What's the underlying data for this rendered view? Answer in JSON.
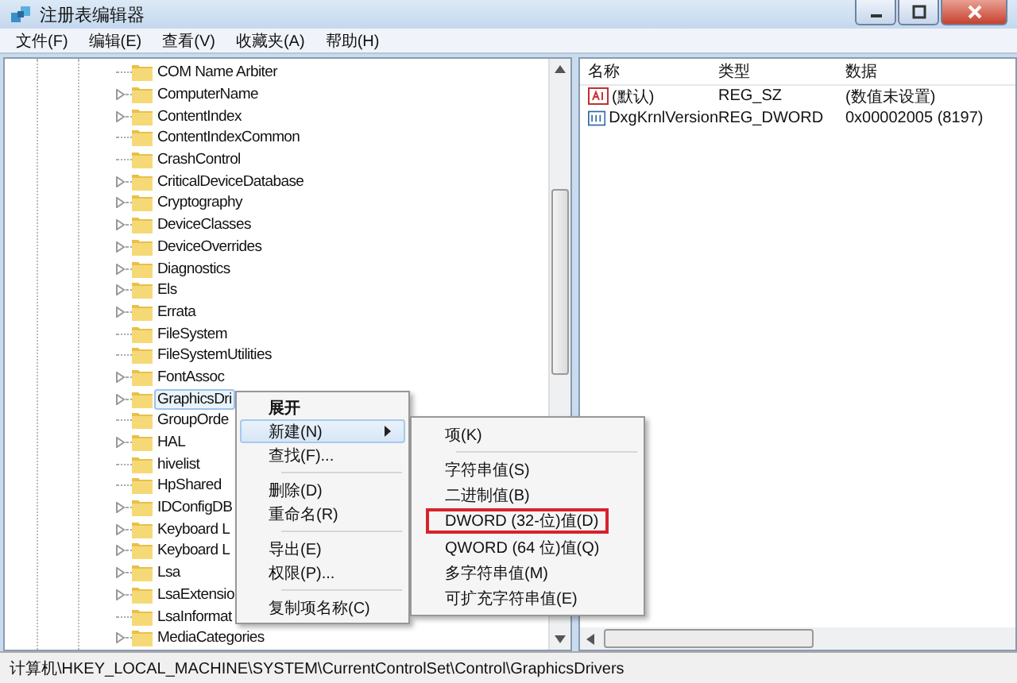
{
  "window": {
    "title": "注册表编辑器"
  },
  "menu": [
    "文件(F)",
    "编辑(E)",
    "查看(V)",
    "收藏夹(A)",
    "帮助(H)"
  ],
  "tree": {
    "items": [
      {
        "label": "COM Name Arbiter",
        "expandable": false,
        "selected": false
      },
      {
        "label": "ComputerName",
        "expandable": true,
        "selected": false
      },
      {
        "label": "ContentIndex",
        "expandable": true,
        "selected": false
      },
      {
        "label": "ContentIndexCommon",
        "expandable": false,
        "selected": false
      },
      {
        "label": "CrashControl",
        "expandable": false,
        "selected": false
      },
      {
        "label": "CriticalDeviceDatabase",
        "expandable": true,
        "selected": false
      },
      {
        "label": "Cryptography",
        "expandable": true,
        "selected": false
      },
      {
        "label": "DeviceClasses",
        "expandable": true,
        "selected": false
      },
      {
        "label": "DeviceOverrides",
        "expandable": true,
        "selected": false
      },
      {
        "label": "Diagnostics",
        "expandable": true,
        "selected": false
      },
      {
        "label": "Els",
        "expandable": true,
        "selected": false
      },
      {
        "label": "Errata",
        "expandable": true,
        "selected": false
      },
      {
        "label": "FileSystem",
        "expandable": false,
        "selected": false
      },
      {
        "label": "FileSystemUtilities",
        "expandable": false,
        "selected": false
      },
      {
        "label": "FontAssoc",
        "expandable": true,
        "selected": false
      },
      {
        "label": "GraphicsDri",
        "expandable": true,
        "selected": true
      },
      {
        "label": "GroupOrde",
        "expandable": false,
        "selected": false
      },
      {
        "label": "HAL",
        "expandable": true,
        "selected": false
      },
      {
        "label": "hivelist",
        "expandable": false,
        "selected": false
      },
      {
        "label": "HpShared",
        "expandable": false,
        "selected": false
      },
      {
        "label": "IDConfigDB",
        "expandable": true,
        "selected": false
      },
      {
        "label": "Keyboard L",
        "expandable": true,
        "selected": false
      },
      {
        "label": "Keyboard L",
        "expandable": true,
        "selected": false
      },
      {
        "label": "Lsa",
        "expandable": true,
        "selected": false
      },
      {
        "label": "LsaExtensio",
        "expandable": true,
        "selected": false
      },
      {
        "label": "LsaInformat",
        "expandable": false,
        "selected": false
      },
      {
        "label": "MediaCategories",
        "expandable": true,
        "selected": false
      }
    ]
  },
  "values": {
    "columns": [
      "名称",
      "类型",
      "数据"
    ],
    "rows": [
      {
        "kind": "string",
        "name": "(默认)",
        "type": "REG_SZ",
        "data": "(数值未设置)"
      },
      {
        "kind": "binary",
        "name": "DxgKrnlVersion",
        "type": "REG_DWORD",
        "data": "0x00002005 (8197)"
      }
    ]
  },
  "context_menu": {
    "items": [
      {
        "kind": "item",
        "label": "展开",
        "bold": true,
        "selected": false,
        "submenu": false
      },
      {
        "kind": "item",
        "label": "新建(N)",
        "bold": false,
        "selected": true,
        "submenu": true
      },
      {
        "kind": "item",
        "label": "查找(F)...",
        "bold": false,
        "selected": false,
        "submenu": false
      },
      {
        "kind": "separator"
      },
      {
        "kind": "item",
        "label": "删除(D)",
        "bold": false,
        "selected": false,
        "submenu": false
      },
      {
        "kind": "item",
        "label": "重命名(R)",
        "bold": false,
        "selected": false,
        "submenu": false
      },
      {
        "kind": "separator"
      },
      {
        "kind": "item",
        "label": "导出(E)",
        "bold": false,
        "selected": false,
        "submenu": false
      },
      {
        "kind": "item",
        "label": "权限(P)...",
        "bold": false,
        "selected": false,
        "submenu": false
      },
      {
        "kind": "separator"
      },
      {
        "kind": "item",
        "label": "复制项名称(C)",
        "bold": false,
        "selected": false,
        "submenu": false
      }
    ]
  },
  "submenu": {
    "items": [
      {
        "kind": "item",
        "label": "项(K)",
        "outlined": false
      },
      {
        "kind": "separator"
      },
      {
        "kind": "item",
        "label": "字符串值(S)",
        "outlined": false
      },
      {
        "kind": "item",
        "label": "二进制值(B)",
        "outlined": false
      },
      {
        "kind": "item",
        "label": "DWORD (32-位)值(D)",
        "outlined": true
      },
      {
        "kind": "item",
        "label": "QWORD (64 位)值(Q)",
        "outlined": false
      },
      {
        "kind": "item",
        "label": "多字符串值(M)",
        "outlined": false
      },
      {
        "kind": "item",
        "label": "可扩充字符串值(E)",
        "outlined": false
      }
    ]
  },
  "status_bar": "计算机\\HKEY_LOCAL_MACHINE\\SYSTEM\\CurrentControlSet\\Control\\GraphicsDrivers"
}
